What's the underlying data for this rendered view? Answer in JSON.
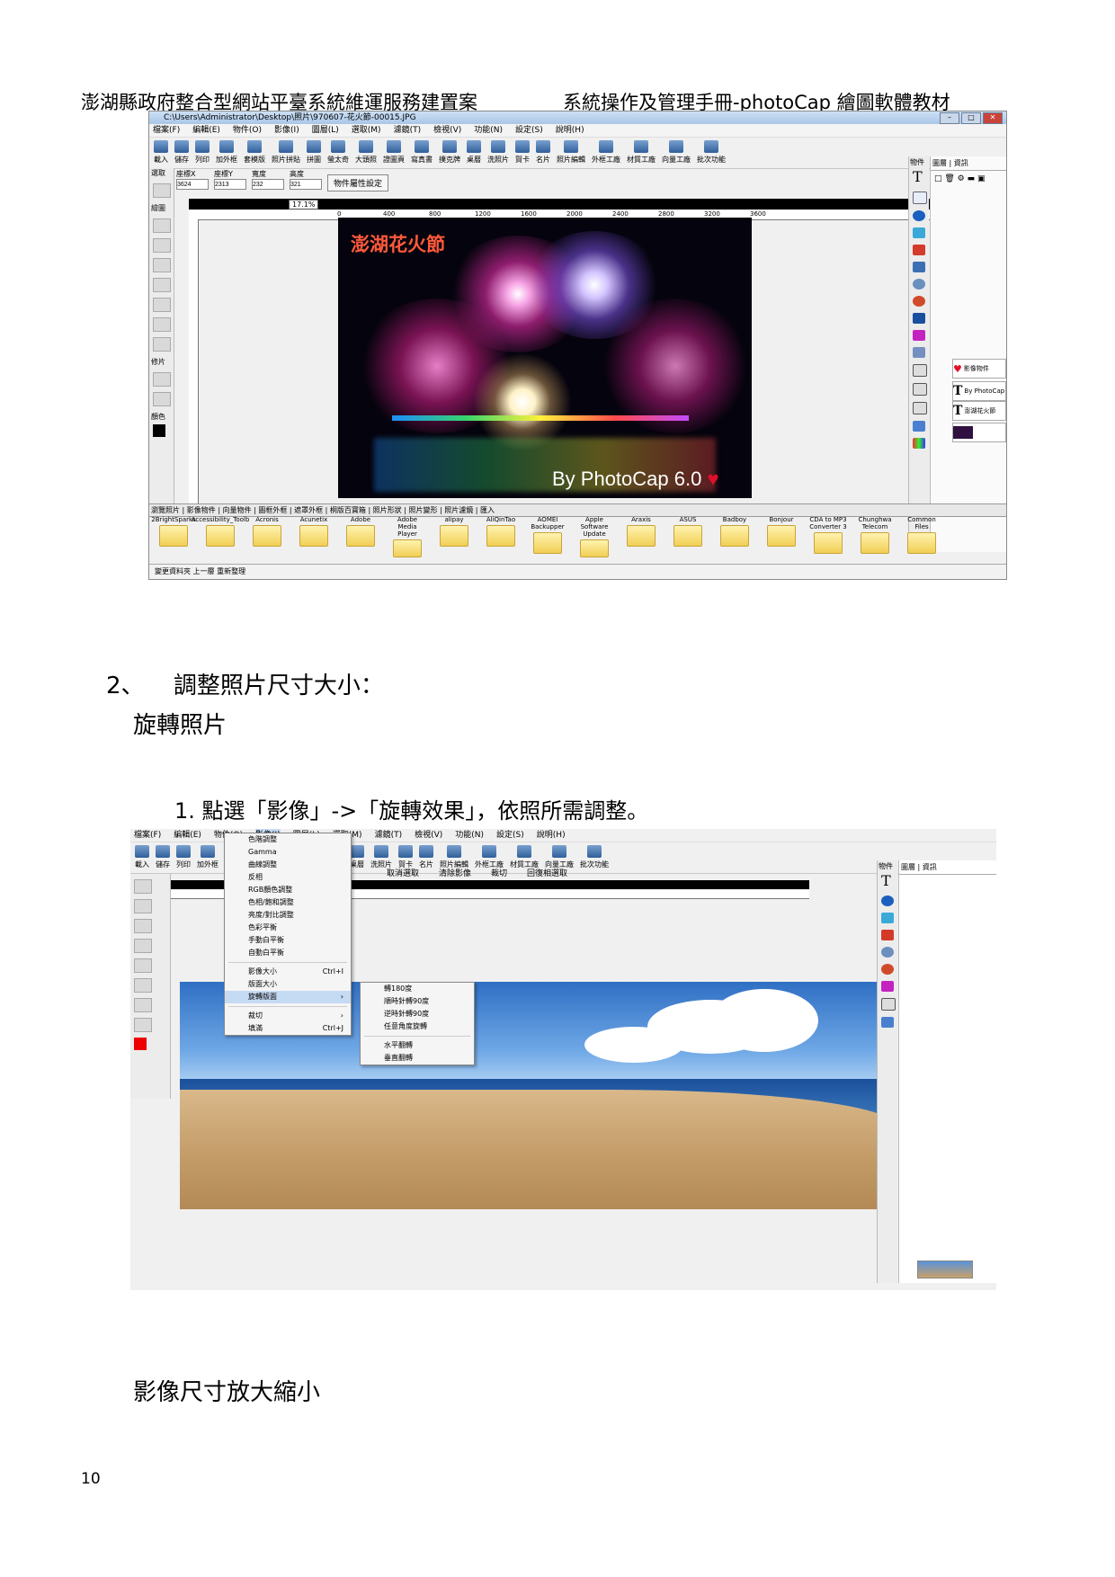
{
  "header": {
    "left": "澎湖縣政府整合型網站平臺系統維運服務建置案",
    "right": "系統操作及管理手冊-photoCap 繪圖軟體教材"
  },
  "screenshot1": {
    "window_title": "C:\\Users\\Administrator\\Desktop\\照片\\970607-花火節-00015.JPG",
    "menu": [
      "檔案(F)",
      "編輯(E)",
      "物件(O)",
      "影像(I)",
      "圖層(L)",
      "選取(M)",
      "濾鏡(T)",
      "檢視(V)",
      "功能(N)",
      "設定(S)",
      "說明(H)"
    ],
    "toolbar": [
      "載入",
      "儲存",
      "列印",
      "加外框",
      "套模版",
      "照片拼貼",
      "拼圖",
      "螢太奇",
      "大頭照",
      "證圖頁",
      "寫真書",
      "撲克牌",
      "桌曆",
      "洗照片",
      "賀卡",
      "名片",
      "照片編輯",
      "外框工廠",
      "材質工廠",
      "向量工廠",
      "批次功能"
    ],
    "left_labels": [
      "選取",
      "繪圖",
      "修片",
      "顏色"
    ],
    "props": {
      "x_label": "座標X",
      "x_value": "3624",
      "y_label": "座標Y",
      "y_value": "2313",
      "w_label": "寬度",
      "w_value": "232",
      "h_label": "高度",
      "h_value": "321",
      "button": "物件屬性設定"
    },
    "zoom": "17.1%",
    "ruler": [
      "0",
      "400",
      "800",
      "1200",
      "1600",
      "2000",
      "2400",
      "2800",
      "3200",
      "3600"
    ],
    "photo_title": "澎湖花火節",
    "photo_caption": "By PhotoCap 6.0",
    "right_tabs": [
      "物件",
      "圖層",
      "資訊"
    ],
    "layers": [
      "影像物件",
      "By PhotoCap",
      "澎湖花火節"
    ],
    "bottom_tabs": "瀏覽照片 | 影像物件 | 向量物件 | 圖框外框 | 遮罩外框 | 桐版百寶箱 | 照片形狀 | 照片變形 | 照片濾鏡 | 匯入",
    "folders": [
      "2BrightSparks",
      "Accessibility_Toolb",
      "Acronis",
      "Acunetix",
      "Adobe",
      "Adobe Media Player",
      "alipay",
      "AliQinTao",
      "AOMEI Backupper",
      "Apple Software Update",
      "Araxis",
      "ASUS",
      "Badboy",
      "Bonjour",
      "CDA to MP3 Converter 3",
      "Chunghwa Telecom",
      "Common Files"
    ],
    "status": "變更資料夾   上一層   重新整理"
  },
  "section": {
    "number": "2、",
    "title": "調整照片尺寸大小：",
    "subtitle": "旋轉照片",
    "step1": "1. 點選「影像」->「旋轉效果」，依照所需調整。",
    "subtitle2": "影像尺寸放大縮小"
  },
  "screenshot2": {
    "menu": [
      "檔案(F)",
      "編輯(E)",
      "物件(O)",
      "影像(I)",
      "圖層(L)",
      "選取(M)",
      "濾鏡(T)",
      "檢視(V)",
      "功能(N)",
      "設定(S)",
      "說明(H)"
    ],
    "toolbar": [
      "載入",
      "儲存",
      "列印",
      "加外框",
      "套模",
      "",
      "證圖頁",
      "寫真書",
      "撲克牌",
      "桌曆",
      "洗照片",
      "賀卡",
      "名片",
      "照片編輯",
      "外框工廠",
      "材質工廠",
      "向量工廠",
      "批次功能"
    ],
    "image_menu": [
      "色階調整",
      "Gamma",
      "曲線調整",
      "反相",
      "RGB顏色調整",
      "色相/飽和調整",
      "亮度/對比調整",
      "色彩平衡",
      "手動白平衡",
      "自動白平衡",
      "影像大小",
      "版面大小",
      "旋轉版面",
      "裁切",
      "填滿"
    ],
    "shortcut_size": "Ctrl+I",
    "shortcut_fill": "Ctrl+J",
    "rotate_submenu": [
      "轉180度",
      "順時針轉90度",
      "逆時針轉90度",
      "任意角度旋轉",
      "水平翻轉",
      "垂直翻轉"
    ],
    "options": [
      "取消選取",
      "清除影像",
      "裁切",
      "回復相選取"
    ],
    "right_tabs": [
      "物件",
      "圖層",
      "資訊"
    ]
  },
  "page_number": "10"
}
